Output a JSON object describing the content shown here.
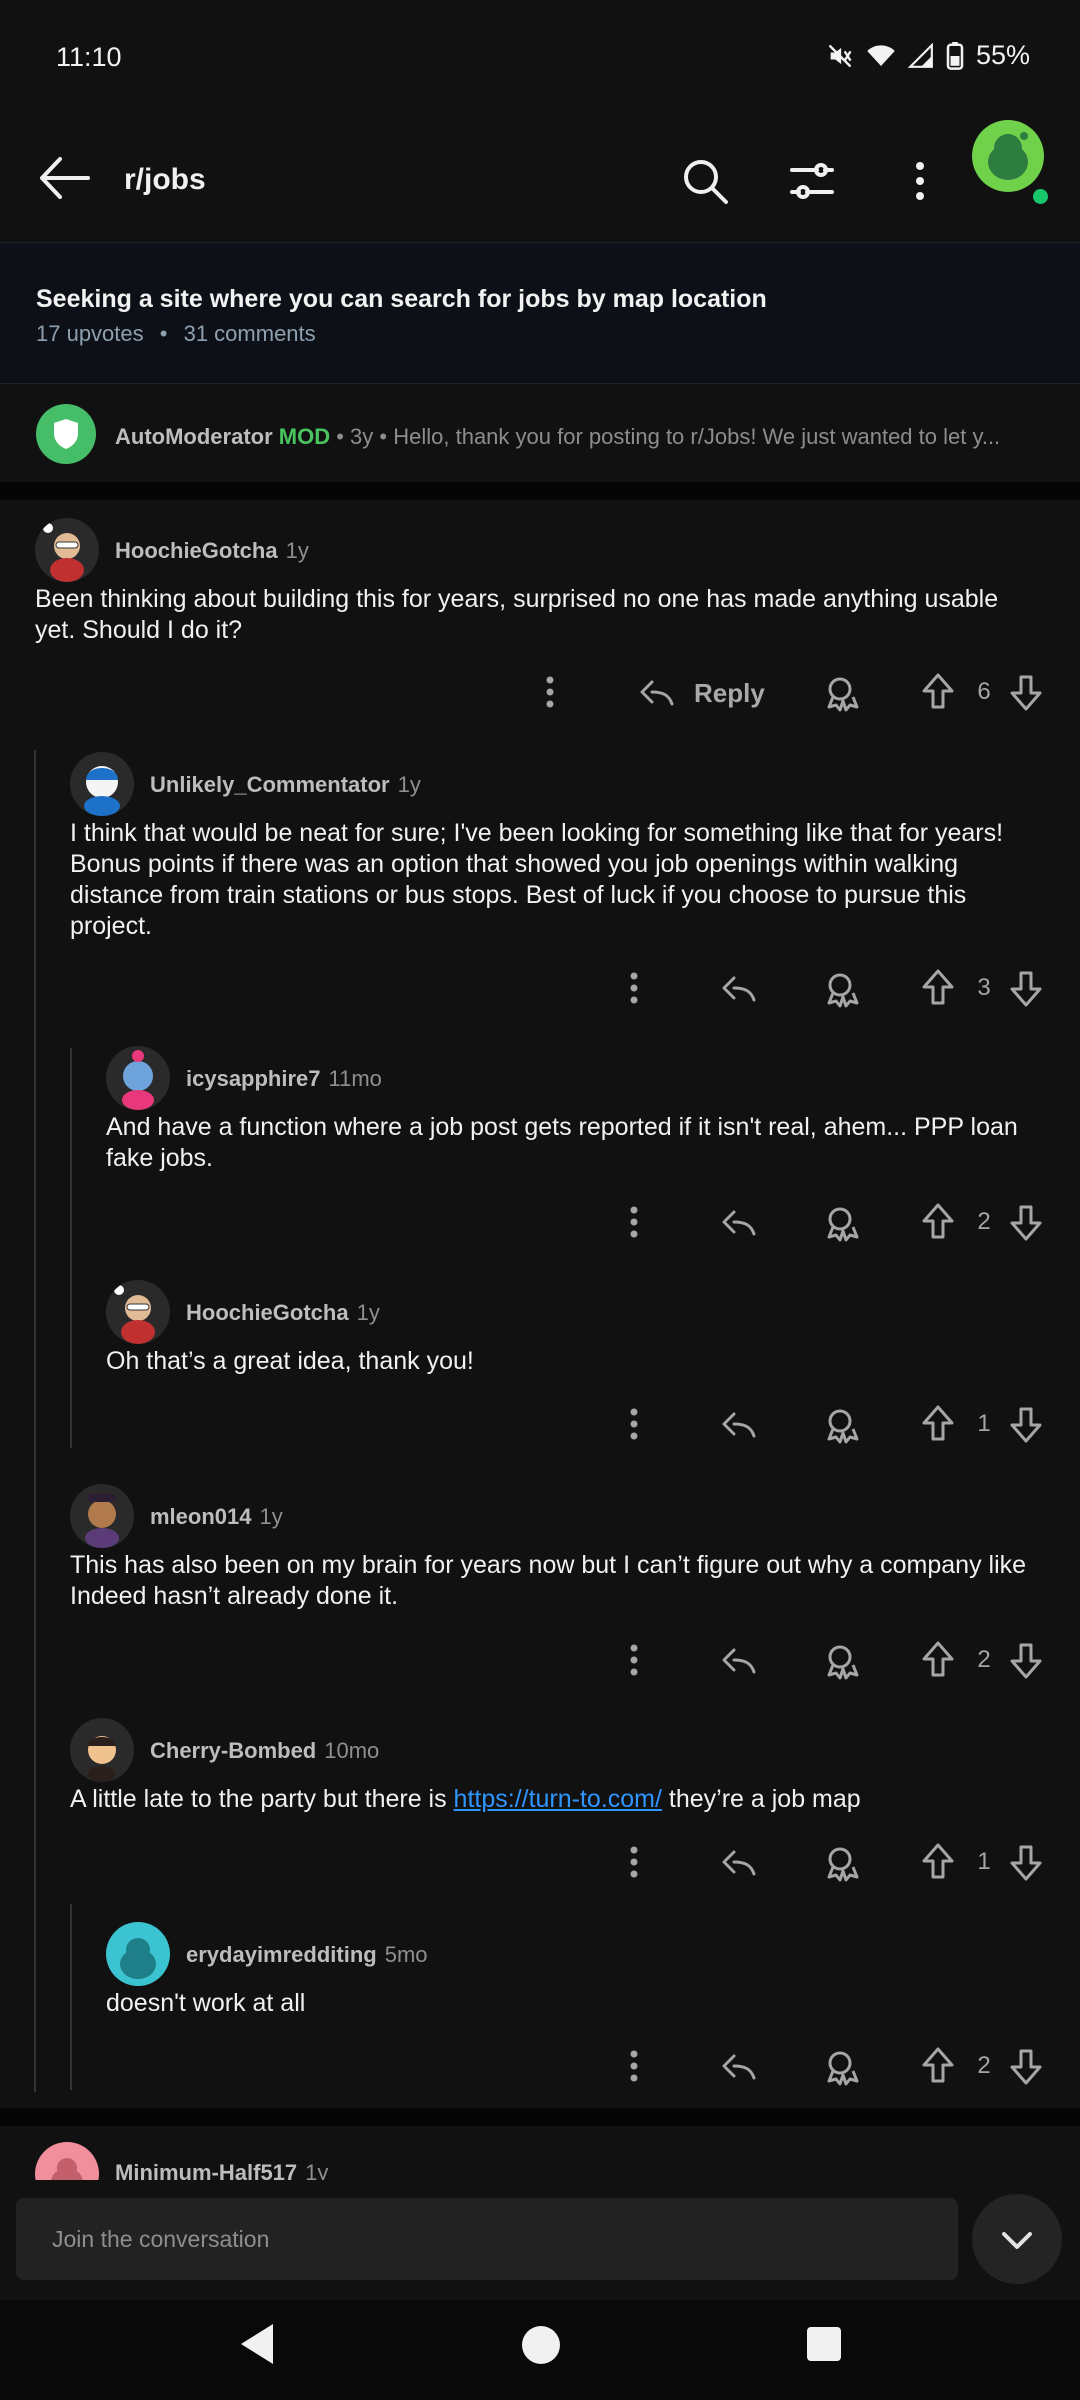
{
  "status": {
    "time": "11:10",
    "battery": "55%"
  },
  "topbar": {
    "subreddit": "r/jobs"
  },
  "post": {
    "title": "Seeking a site where you can search for jobs by map location",
    "upvotes": "17 upvotes",
    "separator": "•",
    "comments": "31 comments"
  },
  "automod": {
    "name": "AutoModerator",
    "badge": "MOD",
    "meta": "• 3y •",
    "preview": "Hello, thank you for posting to r/Jobs! We just wanted to let y..."
  },
  "comments": [
    {
      "author": "HoochieGotcha",
      "age": "1y",
      "body": "Been thinking about building this for years, surprised no one has made anything usable yet. Should I do it?",
      "reply_label": "Reply",
      "score": "6"
    },
    {
      "author": "Unlikely_Commentator",
      "age": "1y",
      "body": "I think that would be neat for sure; I've been looking for something like that for years! Bonus points if there was an option that showed you job openings within walking distance from train stations or bus stops. Best of luck if you choose to pursue this project.",
      "score": "3"
    },
    {
      "author": "icysapphire7",
      "age": "11mo",
      "body": "And have a function where a job post gets reported if it isn't real, ahem... PPP loan fake jobs.",
      "score": "2"
    },
    {
      "author": "HoochieGotcha",
      "age": "1y",
      "body": "Oh that’s a great idea, thank you!",
      "score": "1"
    },
    {
      "author": "mleon014",
      "age": "1y",
      "body": "This has also been on my brain for years now but I can’t figure out why a company like Indeed hasn’t already done it.",
      "score": "2"
    },
    {
      "author": "Cherry-Bombed",
      "age": "10mo",
      "body_before": "A little late to the party but there is ",
      "link": "https://turn-to.com/",
      "body_after": " they’re a job map",
      "score": "1"
    },
    {
      "author": "erydayimredditing",
      "age": "5mo",
      "body": "doesn't work at all",
      "score": "2"
    },
    {
      "author": "Minimum-Half517",
      "age": "1y"
    }
  ],
  "composer": {
    "placeholder": "Join the conversation"
  },
  "colors": {
    "background": "#111111",
    "link": "#2f95ff",
    "mod": "#49c45f"
  }
}
